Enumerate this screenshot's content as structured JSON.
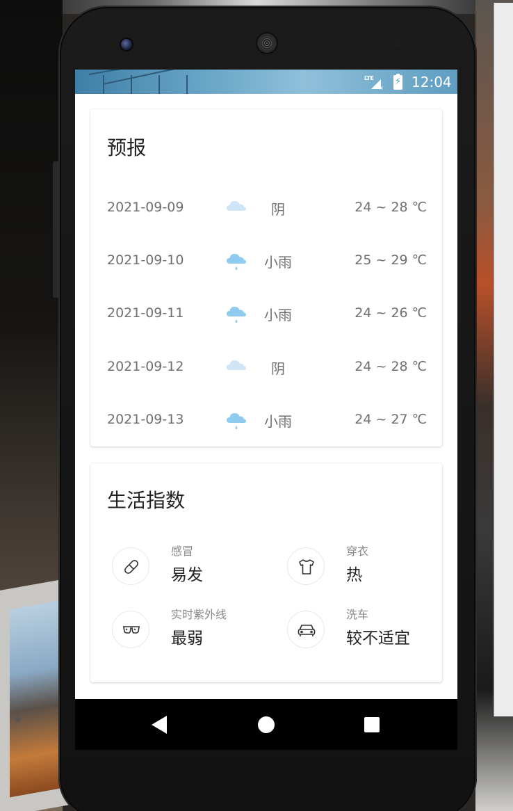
{
  "statusbar": {
    "network": "LTE",
    "time": "12:04"
  },
  "forecast": {
    "title": "预报",
    "rows": [
      {
        "date": "2021-09-09",
        "icon": "cloudy-icon",
        "condition": "阴",
        "temp": "24 ~ 28 ℃"
      },
      {
        "date": "2021-09-10",
        "icon": "light-rain-icon",
        "condition": "小雨",
        "temp": "25 ~ 29 ℃"
      },
      {
        "date": "2021-09-11",
        "icon": "light-rain-icon",
        "condition": "小雨",
        "temp": "24 ~ 26 ℃"
      },
      {
        "date": "2021-09-12",
        "icon": "cloudy-icon",
        "condition": "阴",
        "temp": "24 ~ 28 ℃"
      },
      {
        "date": "2021-09-13",
        "icon": "light-rain-icon",
        "condition": "小雨",
        "temp": "24 ~ 27 ℃"
      }
    ]
  },
  "life": {
    "title": "生活指数",
    "items": [
      {
        "icon": "pill-icon",
        "label": "感冒",
        "value": "易发"
      },
      {
        "icon": "tshirt-icon",
        "label": "穿衣",
        "value": "热"
      },
      {
        "icon": "sunglasses-icon",
        "label": "实时紫外线",
        "value": "最弱"
      },
      {
        "icon": "car-icon",
        "label": "洗车",
        "value": "较不适宜"
      }
    ]
  },
  "colors": {
    "cloud": "#cfe4f6",
    "rain_cloud": "#8fcbef",
    "text_primary": "#222222",
    "text_secondary": "#6f6f6f"
  }
}
